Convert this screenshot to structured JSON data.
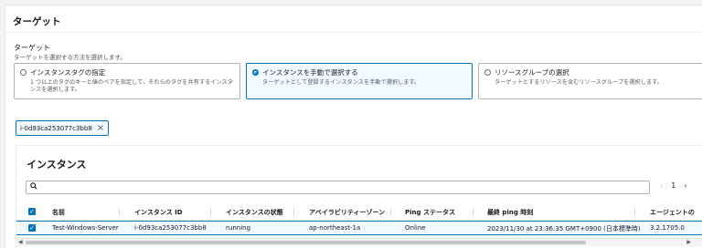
{
  "header": {
    "title": "ターゲット"
  },
  "target_section": {
    "label": "ターゲット",
    "description": "ターゲットを選択する方法を選択します。",
    "options": [
      {
        "label": "インスタンスタグの指定",
        "description": "1 つ以上のタグのキーと値のペアを指定して、それらのタグを共有するインスタンスを選択します。",
        "selected": false
      },
      {
        "label": "インスタンスを手動で選択する",
        "description": "ターゲットとして登録するインスタンスを手動で選択します。",
        "selected": true
      },
      {
        "label": "リソースグループの選択",
        "description": "ターゲットとするリソースを含むリソースグループを選択します。",
        "selected": false
      }
    ]
  },
  "selected_token": {
    "label": "i-0d93ca253077c3bb8"
  },
  "instances": {
    "title": "インスタンス",
    "pagination": {
      "prev": "‹",
      "page": "1",
      "next": "›"
    },
    "columns": [
      "名前",
      "インスタンス ID",
      "インスタンスの状態",
      "アベイラビリティーゾーン",
      "Ping ステータス",
      "最終 ping 時刻",
      "エージェントの"
    ],
    "rows": [
      [
        "Test-Windows-Server",
        "i-0d93ca253077c3bb8",
        "running",
        "ap-northeast-1a",
        "Online",
        "2023/11/30 at 23:36:35 GMT+0900 (日本標準時)",
        "3.2.1705.0"
      ]
    ]
  },
  "icons": {
    "search": "search-icon",
    "close": "close-icon",
    "check": "checkbox-checked-icon"
  },
  "colors": {
    "accent": "#0073bb",
    "selected_bg": "#f1faff"
  }
}
